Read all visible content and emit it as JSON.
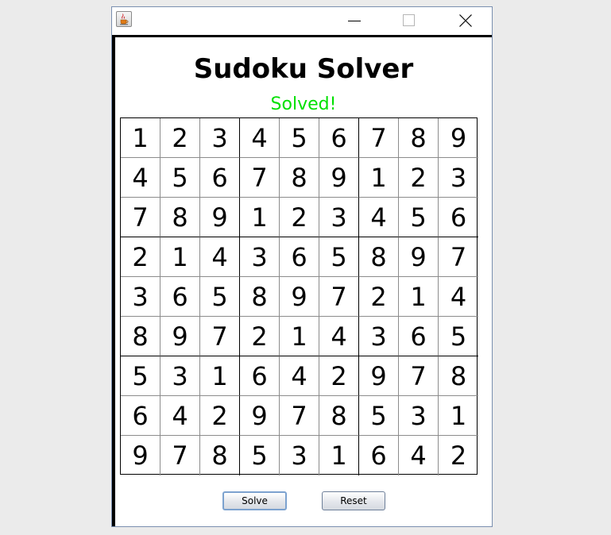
{
  "window": {
    "title_icon": "java-cup-icon",
    "controls": [
      "minimize-icon",
      "maximize-icon",
      "close-icon"
    ]
  },
  "app": {
    "title": "Sudoku Solver",
    "status": "Solved!",
    "status_color": "#00e000"
  },
  "grid": [
    [
      "1",
      "2",
      "3",
      "4",
      "5",
      "6",
      "7",
      "8",
      "9"
    ],
    [
      "4",
      "5",
      "6",
      "7",
      "8",
      "9",
      "1",
      "2",
      "3"
    ],
    [
      "7",
      "8",
      "9",
      "1",
      "2",
      "3",
      "4",
      "5",
      "6"
    ],
    [
      "2",
      "1",
      "4",
      "3",
      "6",
      "5",
      "8",
      "9",
      "7"
    ],
    [
      "3",
      "6",
      "5",
      "8",
      "9",
      "7",
      "2",
      "1",
      "4"
    ],
    [
      "8",
      "9",
      "7",
      "2",
      "1",
      "4",
      "3",
      "6",
      "5"
    ],
    [
      "5",
      "3",
      "1",
      "6",
      "4",
      "2",
      "9",
      "7",
      "8"
    ],
    [
      "6",
      "4",
      "2",
      "9",
      "7",
      "8",
      "5",
      "3",
      "1"
    ],
    [
      "9",
      "7",
      "8",
      "5",
      "3",
      "1",
      "6",
      "4",
      "2"
    ]
  ],
  "buttons": {
    "solve_label": "Solve",
    "reset_label": "Reset"
  }
}
